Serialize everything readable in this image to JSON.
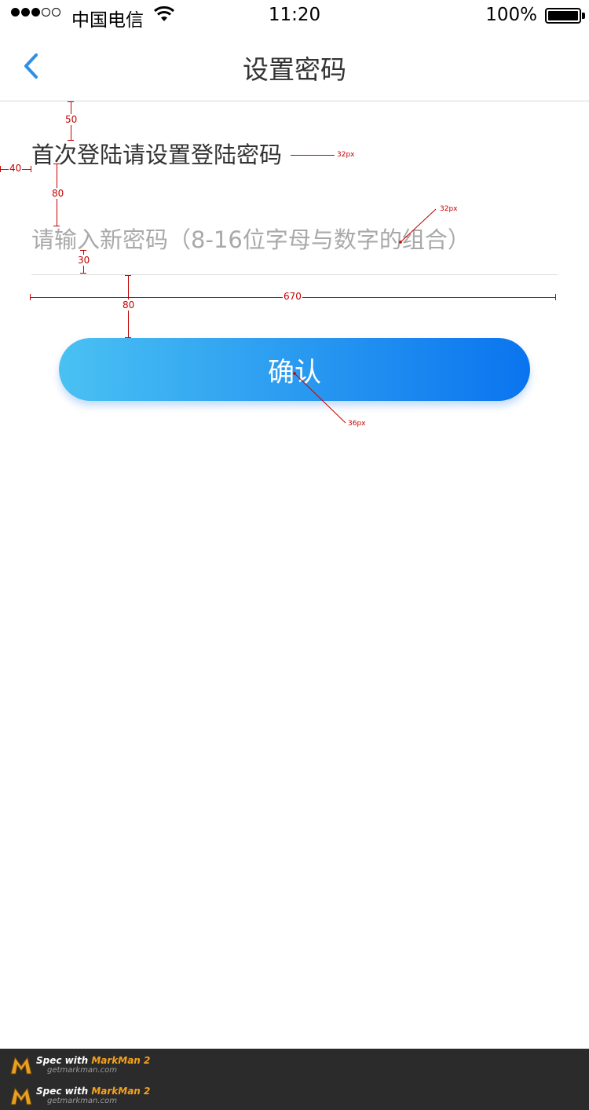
{
  "status_bar": {
    "carrier": "中国电信",
    "time": "11:20",
    "battery": "100%",
    "battery_level": 1.0,
    "signal_bars": 3,
    "signal_total": 5
  },
  "nav": {
    "title": "设置密码",
    "back_icon": "chevron-left-icon"
  },
  "form": {
    "prompt": "首次登陆请设置登陆密码",
    "password_placeholder": "请输入新密码（8-16位字母与数字的组合）",
    "password_value": ""
  },
  "confirm_button": {
    "label": "确认"
  },
  "spec_annotations": {
    "top_gap": "50",
    "left_margin": "40",
    "prompt_to_input_gap": "80",
    "input_bottom_gap": "30",
    "field_width": "670",
    "input_to_button_gap": "80",
    "prompt_font": "32px",
    "placeholder_font": "32px",
    "button_font": "36px"
  },
  "footer": {
    "watermarks": [
      {
        "prefix": "Spec with ",
        "brand": "MarkMan 2",
        "site": "getmarkman.com"
      },
      {
        "prefix": "Spec with ",
        "brand": "MarkMan 2",
        "site": "getmarkman.com"
      }
    ]
  },
  "colors": {
    "accent": "#1e90ff",
    "button_gradient_start": "#4ac1f2",
    "button_gradient_end": "#0a74ef",
    "annotation": "#c40000"
  }
}
